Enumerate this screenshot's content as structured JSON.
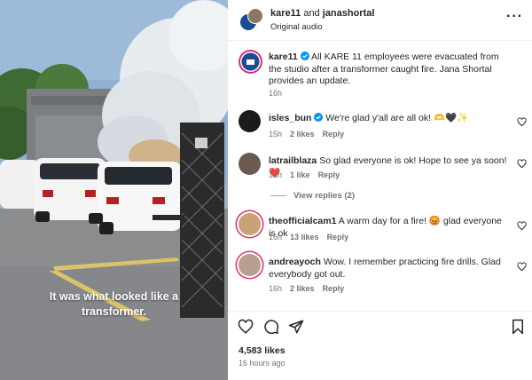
{
  "video": {
    "caption_line1": "It was what looked like a",
    "caption_line2": "transformer."
  },
  "header": {
    "user1": "kare11",
    "joiner": " and ",
    "user2": "janashortal",
    "audio": "Original audio"
  },
  "post": {
    "user": "kare11",
    "text": "All KARE 11 employees were evacuated from the studio after a transformer caught fire. Jana Shortal provides an update.",
    "time": "16h"
  },
  "comments": [
    {
      "user": "isles_bun",
      "text": "We're glad y'all are all ok! 🫶🖤✨",
      "time": "15h",
      "likes": "2 likes",
      "reply": "Reply",
      "avatar_color": "#1b1b1b"
    },
    {
      "user": "latrailblaza",
      "text": "So glad everyone is ok! Hope to see ya soon! ❤️",
      "time": "13h",
      "likes": "1 like",
      "reply": "Reply",
      "avatar_color": "#6b5a4e"
    },
    {
      "user": "theofficialcam1",
      "text": "A warm day for a fire! 😡 glad everyone is ok",
      "time": "16h",
      "likes": "13 likes",
      "reply": "Reply",
      "avatar_color": "#c9a27a"
    },
    {
      "user": "andreayoch",
      "text": "Wow. I remember practicing fire drills. Glad everybody got out.",
      "time": "16h",
      "likes": "2 likes",
      "reply": "Reply",
      "avatar_color": "#b7a08e"
    }
  ],
  "view_replies": "View replies (2)",
  "footer": {
    "likes": "4,583 likes",
    "ago": "16 hours ago"
  },
  "icons": [
    "heart-icon",
    "comment-icon",
    "share-icon",
    "bookmark-icon",
    "more-icon",
    "verified-icon"
  ],
  "colors": {
    "verified": "#0095f6",
    "muted": "#737373",
    "text": "#262626"
  }
}
